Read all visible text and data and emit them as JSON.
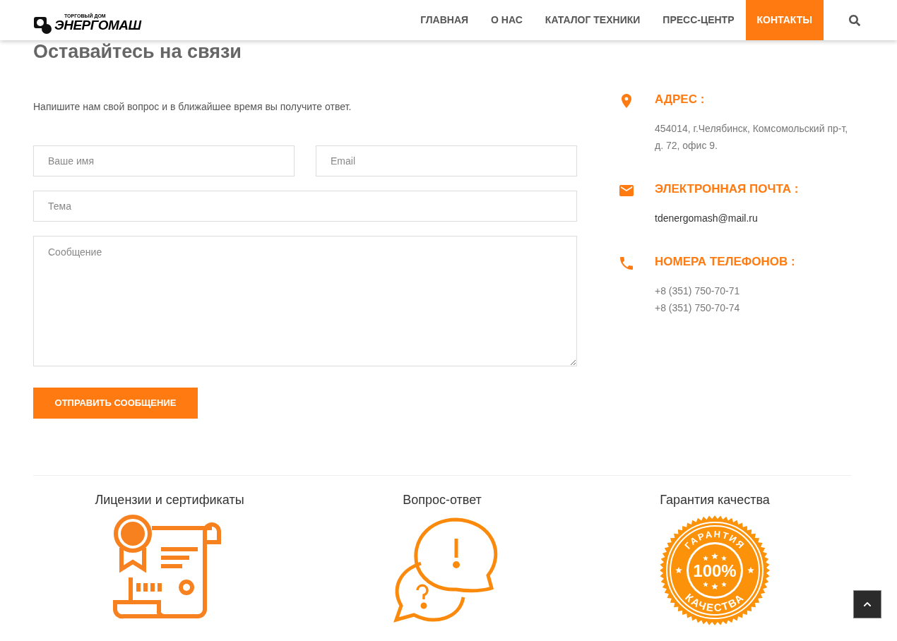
{
  "header": {
    "logo": {
      "tagline": "ТОРГОВЫЙ ДОМ",
      "name": "ЭНЕРГОМАШ"
    },
    "nav": [
      {
        "label": "ГЛАВНАЯ",
        "selected": false
      },
      {
        "label": "О НАС",
        "selected": false
      },
      {
        "label": "КАТАЛОГ ТЕХНИКИ",
        "selected": false
      },
      {
        "label": "ПРЕСС-ЦЕНТР",
        "selected": false
      },
      {
        "label": "КОНТАКТЫ",
        "selected": true
      }
    ]
  },
  "contact_form": {
    "title": "Оставайтесь на связи",
    "intro": "Напишите нам свой вопрос и в ближайшее время вы получите ответ.",
    "fields": [
      {
        "kind": "half",
        "placeholder": "Ваше имя"
      },
      {
        "kind": "half",
        "placeholder": "Email"
      },
      {
        "kind": "full",
        "placeholder": "Тема"
      },
      {
        "kind": "textarea",
        "placeholder": "Сообщение"
      }
    ],
    "submit": "ОТПРАВИТЬ СООБЩЕНИЕ"
  },
  "contacts": [
    {
      "kind": "address",
      "title": "АДРЕС :",
      "lines": [
        "454014, г.Челябинск, Комсомольский пр-т,",
        "д. 72, офис 9."
      ]
    },
    {
      "kind": "email",
      "title": "ЭЛЕКТРОННАЯ ПОЧТА :",
      "lines": [
        "tdenergomash@mail.ru"
      ]
    },
    {
      "kind": "phone",
      "title": "НОМЕРА ТЕЛЕФОНОВ :",
      "lines": [
        "+8 (351) 750-70-71",
        "+8 (351) 750-70-74"
      ]
    }
  ],
  "features": [
    {
      "kind": "certificate",
      "title": "Лицензии и сертификаты"
    },
    {
      "kind": "faq",
      "title": "Вопрос-ответ"
    },
    {
      "kind": "guarantee",
      "title": "Гарантия качества",
      "badge": {
        "top": "ГАРАНТИЯ",
        "center": "100%",
        "bottom": "КАЧЕСТВА"
      }
    }
  ]
}
